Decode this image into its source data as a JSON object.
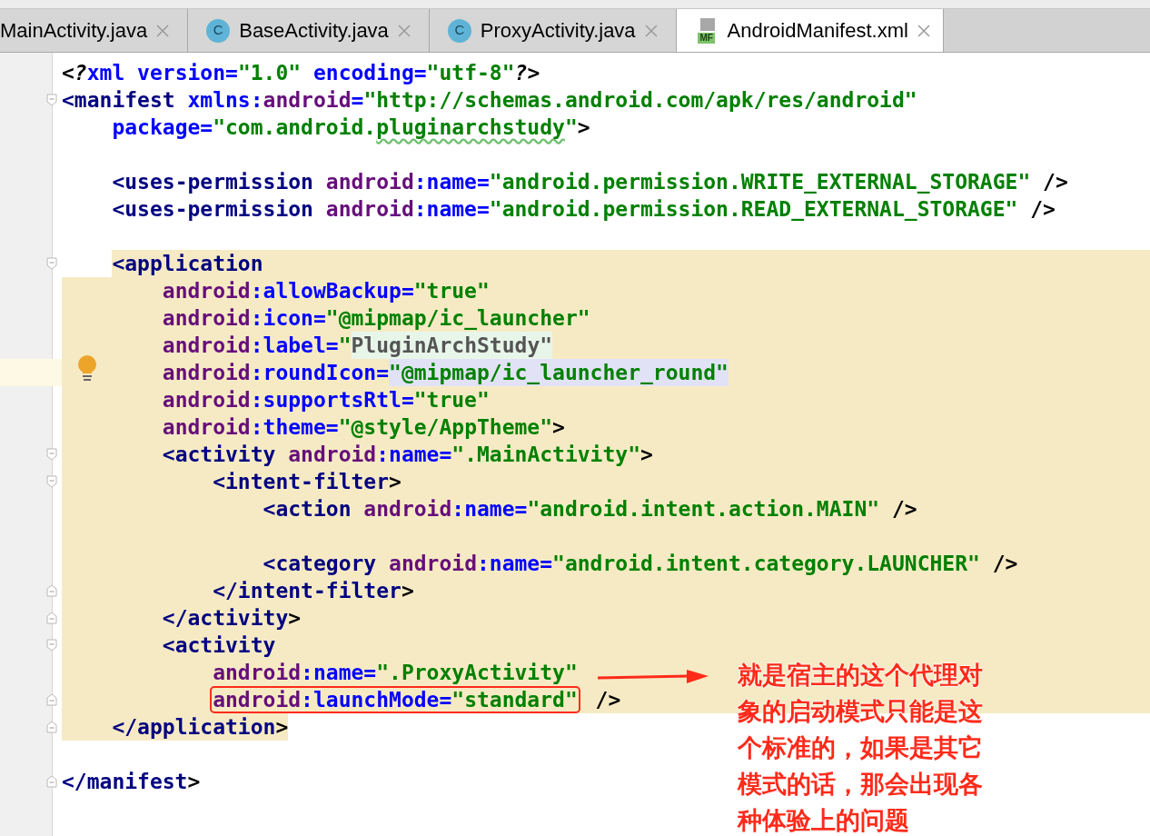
{
  "tabs": [
    {
      "label": "MainActivity.java",
      "selected": false
    },
    {
      "label": "BaseActivity.java",
      "selected": false,
      "icon": {
        "kind": "class",
        "text": "C"
      }
    },
    {
      "label": "ProxyActivity.java",
      "selected": false,
      "icon": {
        "kind": "class",
        "text": "C"
      }
    },
    {
      "label": "AndroidManifest.xml",
      "selected": true,
      "icon": {
        "kind": "manifest",
        "text": "MF"
      }
    }
  ],
  "lines": [
    {
      "highlight": false,
      "tokens": [
        {
          "kind": "pi",
          "t": "<?"
        },
        {
          "kind": "attr",
          "t": "xml "
        },
        {
          "kind": "attr",
          "t": "version="
        },
        {
          "kind": "value",
          "t": "\"1.0\" "
        },
        {
          "kind": "attr",
          "t": "encoding="
        },
        {
          "kind": "value",
          "t": "\"utf-8\""
        },
        {
          "kind": "pi",
          "t": "?>"
        }
      ]
    },
    {
      "highlight": false,
      "fold_start": true,
      "tokens": [
        {
          "kind": "tag",
          "t": "<manifest "
        },
        {
          "kind": "attr",
          "t": "xmlns:"
        },
        {
          "kind": "ns",
          "t": "android"
        },
        {
          "kind": "attr",
          "t": "="
        },
        {
          "kind": "value",
          "t": "\"http://schemas.android.com/apk/res/android\""
        }
      ]
    },
    {
      "highlight": false,
      "tokens": [
        {
          "kind": "attr",
          "t": "    package="
        },
        {
          "kind": "value",
          "t": "\"com.android."
        },
        {
          "kind": "value",
          "t": "pluginarchstudy",
          "typo": true
        },
        {
          "kind": "value",
          "t": "\""
        },
        {
          "kind": "punct",
          "t": ">"
        }
      ]
    },
    {
      "highlight": false
    },
    {
      "highlight": false,
      "tokens": [
        {
          "kind": "tag",
          "t": "    <uses-permission "
        },
        {
          "kind": "ns",
          "t": "android"
        },
        {
          "kind": "attr",
          "t": ":name="
        },
        {
          "kind": "value",
          "t": "\"android.permission.WRITE_EXTERNAL_STORAGE\""
        },
        {
          "kind": "punct",
          "t": " />"
        }
      ]
    },
    {
      "highlight": false,
      "tokens": [
        {
          "kind": "tag",
          "t": "    <uses-permission "
        },
        {
          "kind": "ns",
          "t": "android"
        },
        {
          "kind": "attr",
          "t": ":name="
        },
        {
          "kind": "value",
          "t": "\"android.permission.READ_EXTERNAL_STORAGE\""
        },
        {
          "kind": "punct",
          "t": " />"
        }
      ]
    },
    {
      "highlight": false
    },
    {
      "highlight": true,
      "fold_start": true,
      "tokens": [
        {
          "kind": "tag",
          "t": "    <application"
        }
      ]
    },
    {
      "highlight": true,
      "tokens": [
        {
          "kind": "ns",
          "t": "        android"
        },
        {
          "kind": "attr",
          "t": ":allowBackup="
        },
        {
          "kind": "value",
          "t": "\"true\""
        }
      ]
    },
    {
      "highlight": true,
      "tokens": [
        {
          "kind": "ns",
          "t": "        android"
        },
        {
          "kind": "attr",
          "t": ":icon="
        },
        {
          "kind": "value",
          "t": "\"@mipmap/ic_launcher\""
        }
      ]
    },
    {
      "highlight": true,
      "tokens": [
        {
          "kind": "ns",
          "t": "        android"
        },
        {
          "kind": "attr",
          "t": ":label="
        },
        {
          "kind": "value",
          "t": "\""
        },
        {
          "kind": "plain",
          "t": "PluginArchStudy\"",
          "color": "#e8f6ea"
        }
      ]
    },
    {
      "highlight": true,
      "current": true,
      "bulb": true,
      "tokens": [
        {
          "kind": "ns",
          "t": "        android"
        },
        {
          "kind": "attr",
          "t": ":roundIcon="
        },
        {
          "kind": "value",
          "t": "\"@mipmap/ic_launcher_round\"",
          "color": "#e2e2f6"
        }
      ]
    },
    {
      "highlight": true,
      "tokens": [
        {
          "kind": "ns",
          "t": "        android"
        },
        {
          "kind": "attr",
          "t": ":supportsRtl="
        },
        {
          "kind": "value",
          "t": "\"true\""
        }
      ]
    },
    {
      "highlight": true,
      "tokens": [
        {
          "kind": "ns",
          "t": "        android"
        },
        {
          "kind": "attr",
          "t": ":theme="
        },
        {
          "kind": "value",
          "t": "\"@style/AppTheme\""
        },
        {
          "kind": "punct",
          "t": ">"
        }
      ]
    },
    {
      "highlight": true,
      "fold_start": true,
      "tokens": [
        {
          "kind": "tag",
          "t": "        <activity "
        },
        {
          "kind": "ns",
          "t": "android"
        },
        {
          "kind": "attr",
          "t": ":name="
        },
        {
          "kind": "value",
          "t": "\".MainActivity\""
        },
        {
          "kind": "punct",
          "t": ">"
        }
      ]
    },
    {
      "highlight": true,
      "fold_start": true,
      "tokens": [
        {
          "kind": "tag",
          "t": "            <intent-filter"
        },
        {
          "kind": "punct",
          "t": ">"
        }
      ]
    },
    {
      "highlight": true,
      "tokens": [
        {
          "kind": "tag",
          "t": "                <action "
        },
        {
          "kind": "ns",
          "t": "android"
        },
        {
          "kind": "attr",
          "t": ":name="
        },
        {
          "kind": "value",
          "t": "\"android.intent.action.MAIN\""
        },
        {
          "kind": "punct",
          "t": " />"
        }
      ]
    },
    {
      "highlight": true
    },
    {
      "highlight": true,
      "tokens": [
        {
          "kind": "tag",
          "t": "                <category "
        },
        {
          "kind": "ns",
          "t": "android"
        },
        {
          "kind": "attr",
          "t": ":name="
        },
        {
          "kind": "value",
          "t": "\"android.intent.category.LAUNCHER\""
        },
        {
          "kind": "punct",
          "t": " />"
        }
      ]
    },
    {
      "highlight": true,
      "fold_end": true,
      "tokens": [
        {
          "kind": "tag",
          "t": "            </intent-filter"
        },
        {
          "kind": "punct",
          "t": ">"
        }
      ]
    },
    {
      "highlight": true,
      "fold_end": true,
      "tokens": [
        {
          "kind": "tag",
          "t": "        </activity"
        },
        {
          "kind": "punct",
          "t": ">"
        }
      ]
    },
    {
      "highlight": true,
      "fold_start": true,
      "tokens": [
        {
          "kind": "tag",
          "t": "        <activity"
        }
      ]
    },
    {
      "highlight": true,
      "tokens": [
        {
          "kind": "ns",
          "t": "            android"
        },
        {
          "kind": "attr",
          "t": ":name="
        },
        {
          "kind": "value",
          "t": "\".ProxyActivity\""
        }
      ]
    },
    {
      "highlight": true,
      "fold_end": true,
      "tokens": [
        {
          "kind": "ns",
          "t": "            android",
          "boxed": true
        },
        {
          "kind": "attr",
          "t": ":launchMode=",
          "boxed": true
        },
        {
          "kind": "value",
          "t": "\"standard\"",
          "boxed": true
        },
        {
          "kind": "punct",
          "t": " />"
        }
      ]
    },
    {
      "highlight": true,
      "fold_end": true,
      "tokens": [
        {
          "kind": "tag",
          "t": "    </application"
        },
        {
          "kind": "punct",
          "t": ">"
        }
      ]
    },
    {
      "highlight": false
    },
    {
      "highlight": false,
      "fold_end": true,
      "tokens": [
        {
          "kind": "tag",
          "t": "</manifest"
        },
        {
          "kind": "punct",
          "t": ">"
        }
      ]
    }
  ],
  "annotation": {
    "text": "就是宿主的这个代理对象的启动模式只能是这个标准的，如果是其它模式的话，那会出现各种体验上的问题"
  }
}
